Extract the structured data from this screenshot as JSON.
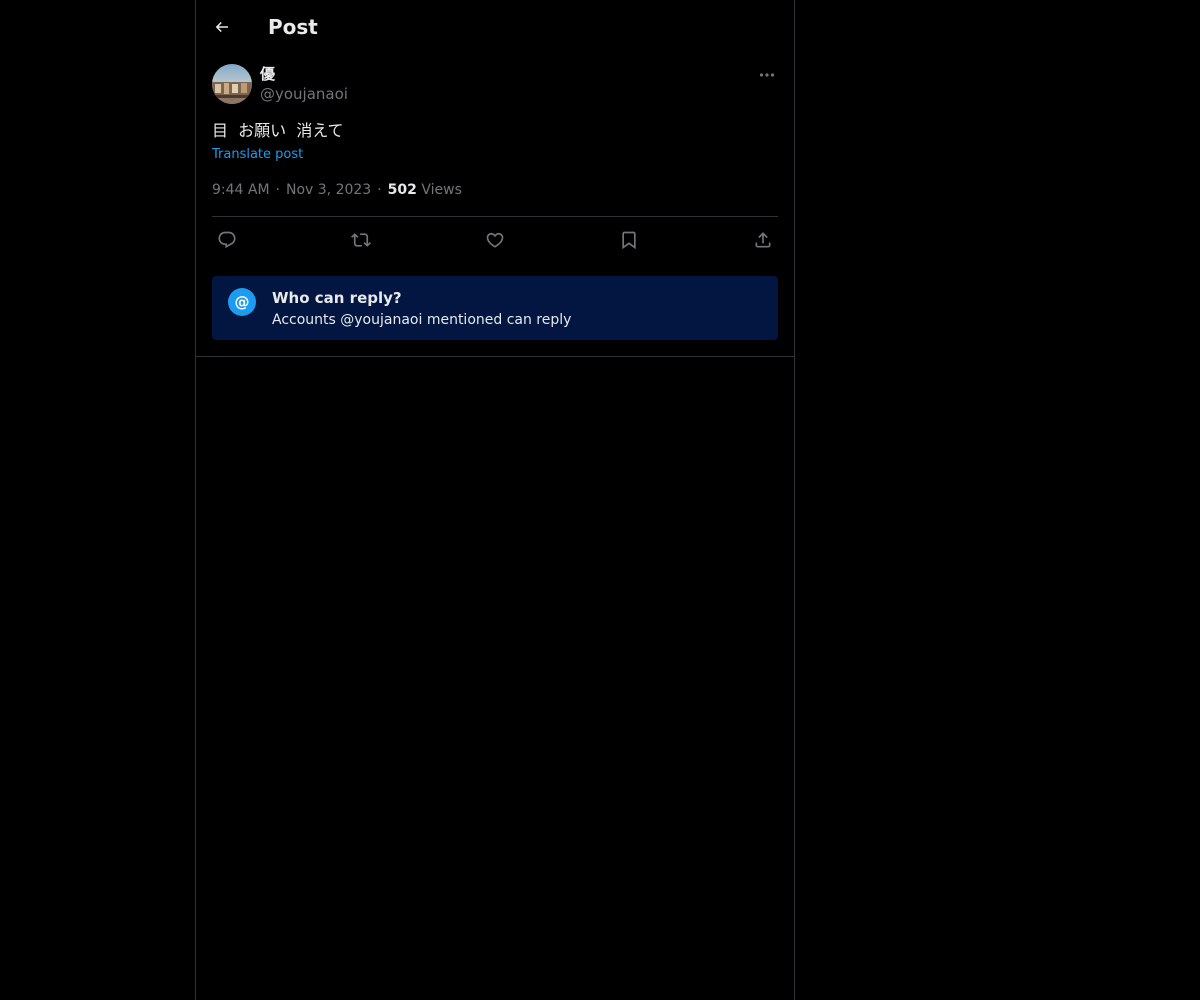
{
  "header": {
    "title": "Post",
    "back_icon": "arrow-left-icon"
  },
  "post": {
    "author": {
      "display_name": "優",
      "handle": "@youjanaoi",
      "avatar": "avatar-photo"
    },
    "text": "目  お願い  消えて",
    "translate_label": "Translate post",
    "time": "9:44 AM",
    "date": "Nov 3, 2023",
    "separator": "·",
    "views_count": "502",
    "views_label": "Views",
    "more_icon": "more-horizontal-icon"
  },
  "actions": [
    {
      "name": "reply",
      "icon": "reply-icon"
    },
    {
      "name": "repost",
      "icon": "repost-icon"
    },
    {
      "name": "like",
      "icon": "heart-icon"
    },
    {
      "name": "bookmark",
      "icon": "bookmark-icon"
    },
    {
      "name": "share",
      "icon": "share-icon"
    }
  ],
  "reply_restriction": {
    "icon_glyph": "@",
    "title": "Who can reply?",
    "subtitle": "Accounts @youjanaoi mentioned can reply"
  },
  "colors": {
    "background": "#000000",
    "text_primary": "#e7e9ea",
    "text_secondary": "#71767b",
    "accent": "#1d9bf0",
    "reply_box": "#031541",
    "border": "#2f3336"
  }
}
